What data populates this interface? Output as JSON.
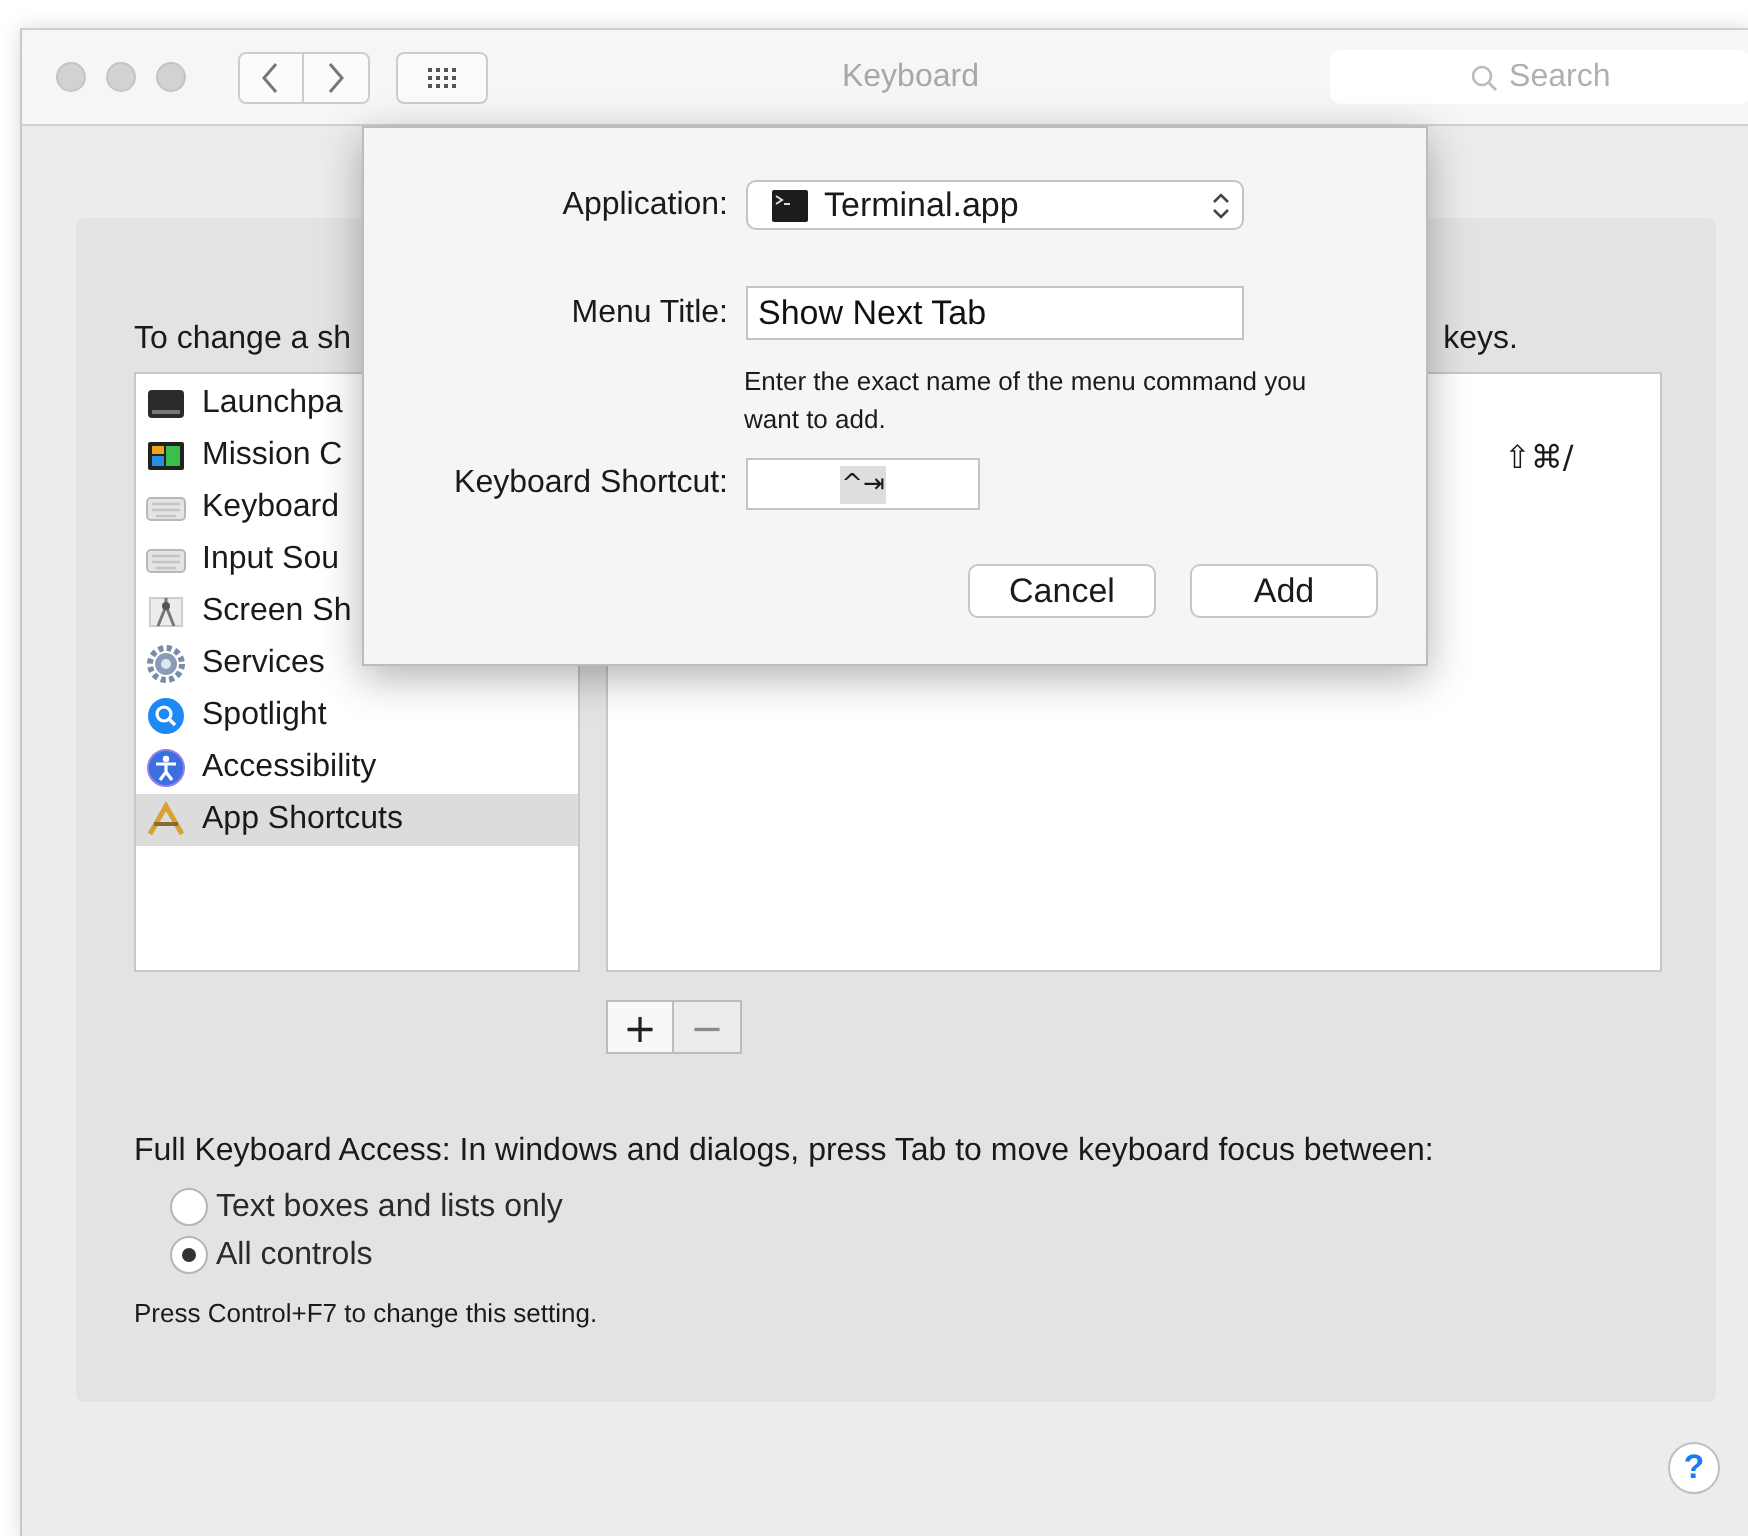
{
  "window": {
    "title": "Keyboard"
  },
  "toolbar": {
    "search": {
      "placeholder": "Search"
    }
  },
  "panel": {
    "instruction_start": "To change a sh",
    "instruction_end": "keys.",
    "categories": [
      {
        "label": "Launchpa",
        "selected": false
      },
      {
        "label": "Mission C",
        "selected": false
      },
      {
        "label": "Keyboard",
        "selected": false
      },
      {
        "label": "Input Sou",
        "selected": false
      },
      {
        "label": "Screen Sh",
        "selected": false
      },
      {
        "label": "Services",
        "selected": false
      },
      {
        "label": "Spotlight",
        "selected": false
      },
      {
        "label": "Accessibility",
        "selected": false
      },
      {
        "label": "App Shortcuts",
        "selected": true
      }
    ],
    "shortcuts": [
      {
        "keys": "⇧⌘/"
      }
    ],
    "list_buttons": [
      {
        "label": "+",
        "disabled": false
      },
      {
        "label": "−",
        "disabled": true
      }
    ],
    "keyboard_access": {
      "label": "Full Keyboard Access: In windows and dialogs, press Tab to move keyboard focus between:",
      "options": [
        {
          "label": "Text boxes and lists only",
          "selected": false
        },
        {
          "label": "All controls",
          "selected": true
        }
      ],
      "note": "Press Control+F7 to change this setting."
    }
  },
  "dialog": {
    "application_label": "Application:",
    "application": "Terminal.app",
    "menu_title_label": "Menu Title:",
    "menu_title": "Show Next Tab",
    "hint": "Enter the exact name of the menu command you want to add.",
    "shortcut_label": "Keyboard Shortcut:",
    "shortcut": "^⇥",
    "buttons": [
      "Cancel",
      "Add"
    ]
  },
  "help": "?"
}
